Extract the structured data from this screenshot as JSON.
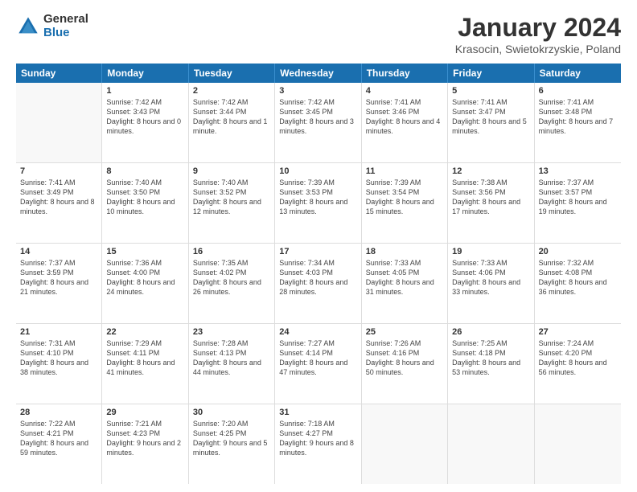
{
  "logo": {
    "general": "General",
    "blue": "Blue"
  },
  "title": "January 2024",
  "subtitle": "Krasocin, Swietokrzyskie, Poland",
  "weekdays": [
    "Sunday",
    "Monday",
    "Tuesday",
    "Wednesday",
    "Thursday",
    "Friday",
    "Saturday"
  ],
  "weeks": [
    [
      {
        "day": "",
        "sunrise": "",
        "sunset": "",
        "daylight": ""
      },
      {
        "day": "1",
        "sunrise": "Sunrise: 7:42 AM",
        "sunset": "Sunset: 3:43 PM",
        "daylight": "Daylight: 8 hours and 0 minutes."
      },
      {
        "day": "2",
        "sunrise": "Sunrise: 7:42 AM",
        "sunset": "Sunset: 3:44 PM",
        "daylight": "Daylight: 8 hours and 1 minute."
      },
      {
        "day": "3",
        "sunrise": "Sunrise: 7:42 AM",
        "sunset": "Sunset: 3:45 PM",
        "daylight": "Daylight: 8 hours and 3 minutes."
      },
      {
        "day": "4",
        "sunrise": "Sunrise: 7:41 AM",
        "sunset": "Sunset: 3:46 PM",
        "daylight": "Daylight: 8 hours and 4 minutes."
      },
      {
        "day": "5",
        "sunrise": "Sunrise: 7:41 AM",
        "sunset": "Sunset: 3:47 PM",
        "daylight": "Daylight: 8 hours and 5 minutes."
      },
      {
        "day": "6",
        "sunrise": "Sunrise: 7:41 AM",
        "sunset": "Sunset: 3:48 PM",
        "daylight": "Daylight: 8 hours and 7 minutes."
      }
    ],
    [
      {
        "day": "7",
        "sunrise": "Sunrise: 7:41 AM",
        "sunset": "Sunset: 3:49 PM",
        "daylight": "Daylight: 8 hours and 8 minutes."
      },
      {
        "day": "8",
        "sunrise": "Sunrise: 7:40 AM",
        "sunset": "Sunset: 3:50 PM",
        "daylight": "Daylight: 8 hours and 10 minutes."
      },
      {
        "day": "9",
        "sunrise": "Sunrise: 7:40 AM",
        "sunset": "Sunset: 3:52 PM",
        "daylight": "Daylight: 8 hours and 12 minutes."
      },
      {
        "day": "10",
        "sunrise": "Sunrise: 7:39 AM",
        "sunset": "Sunset: 3:53 PM",
        "daylight": "Daylight: 8 hours and 13 minutes."
      },
      {
        "day": "11",
        "sunrise": "Sunrise: 7:39 AM",
        "sunset": "Sunset: 3:54 PM",
        "daylight": "Daylight: 8 hours and 15 minutes."
      },
      {
        "day": "12",
        "sunrise": "Sunrise: 7:38 AM",
        "sunset": "Sunset: 3:56 PM",
        "daylight": "Daylight: 8 hours and 17 minutes."
      },
      {
        "day": "13",
        "sunrise": "Sunrise: 7:37 AM",
        "sunset": "Sunset: 3:57 PM",
        "daylight": "Daylight: 8 hours and 19 minutes."
      }
    ],
    [
      {
        "day": "14",
        "sunrise": "Sunrise: 7:37 AM",
        "sunset": "Sunset: 3:59 PM",
        "daylight": "Daylight: 8 hours and 21 minutes."
      },
      {
        "day": "15",
        "sunrise": "Sunrise: 7:36 AM",
        "sunset": "Sunset: 4:00 PM",
        "daylight": "Daylight: 8 hours and 24 minutes."
      },
      {
        "day": "16",
        "sunrise": "Sunrise: 7:35 AM",
        "sunset": "Sunset: 4:02 PM",
        "daylight": "Daylight: 8 hours and 26 minutes."
      },
      {
        "day": "17",
        "sunrise": "Sunrise: 7:34 AM",
        "sunset": "Sunset: 4:03 PM",
        "daylight": "Daylight: 8 hours and 28 minutes."
      },
      {
        "day": "18",
        "sunrise": "Sunrise: 7:33 AM",
        "sunset": "Sunset: 4:05 PM",
        "daylight": "Daylight: 8 hours and 31 minutes."
      },
      {
        "day": "19",
        "sunrise": "Sunrise: 7:33 AM",
        "sunset": "Sunset: 4:06 PM",
        "daylight": "Daylight: 8 hours and 33 minutes."
      },
      {
        "day": "20",
        "sunrise": "Sunrise: 7:32 AM",
        "sunset": "Sunset: 4:08 PM",
        "daylight": "Daylight: 8 hours and 36 minutes."
      }
    ],
    [
      {
        "day": "21",
        "sunrise": "Sunrise: 7:31 AM",
        "sunset": "Sunset: 4:10 PM",
        "daylight": "Daylight: 8 hours and 38 minutes."
      },
      {
        "day": "22",
        "sunrise": "Sunrise: 7:29 AM",
        "sunset": "Sunset: 4:11 PM",
        "daylight": "Daylight: 8 hours and 41 minutes."
      },
      {
        "day": "23",
        "sunrise": "Sunrise: 7:28 AM",
        "sunset": "Sunset: 4:13 PM",
        "daylight": "Daylight: 8 hours and 44 minutes."
      },
      {
        "day": "24",
        "sunrise": "Sunrise: 7:27 AM",
        "sunset": "Sunset: 4:14 PM",
        "daylight": "Daylight: 8 hours and 47 minutes."
      },
      {
        "day": "25",
        "sunrise": "Sunrise: 7:26 AM",
        "sunset": "Sunset: 4:16 PM",
        "daylight": "Daylight: 8 hours and 50 minutes."
      },
      {
        "day": "26",
        "sunrise": "Sunrise: 7:25 AM",
        "sunset": "Sunset: 4:18 PM",
        "daylight": "Daylight: 8 hours and 53 minutes."
      },
      {
        "day": "27",
        "sunrise": "Sunrise: 7:24 AM",
        "sunset": "Sunset: 4:20 PM",
        "daylight": "Daylight: 8 hours and 56 minutes."
      }
    ],
    [
      {
        "day": "28",
        "sunrise": "Sunrise: 7:22 AM",
        "sunset": "Sunset: 4:21 PM",
        "daylight": "Daylight: 8 hours and 59 minutes."
      },
      {
        "day": "29",
        "sunrise": "Sunrise: 7:21 AM",
        "sunset": "Sunset: 4:23 PM",
        "daylight": "Daylight: 9 hours and 2 minutes."
      },
      {
        "day": "30",
        "sunrise": "Sunrise: 7:20 AM",
        "sunset": "Sunset: 4:25 PM",
        "daylight": "Daylight: 9 hours and 5 minutes."
      },
      {
        "day": "31",
        "sunrise": "Sunrise: 7:18 AM",
        "sunset": "Sunset: 4:27 PM",
        "daylight": "Daylight: 9 hours and 8 minutes."
      },
      {
        "day": "",
        "sunrise": "",
        "sunset": "",
        "daylight": ""
      },
      {
        "day": "",
        "sunrise": "",
        "sunset": "",
        "daylight": ""
      },
      {
        "day": "",
        "sunrise": "",
        "sunset": "",
        "daylight": ""
      }
    ]
  ]
}
